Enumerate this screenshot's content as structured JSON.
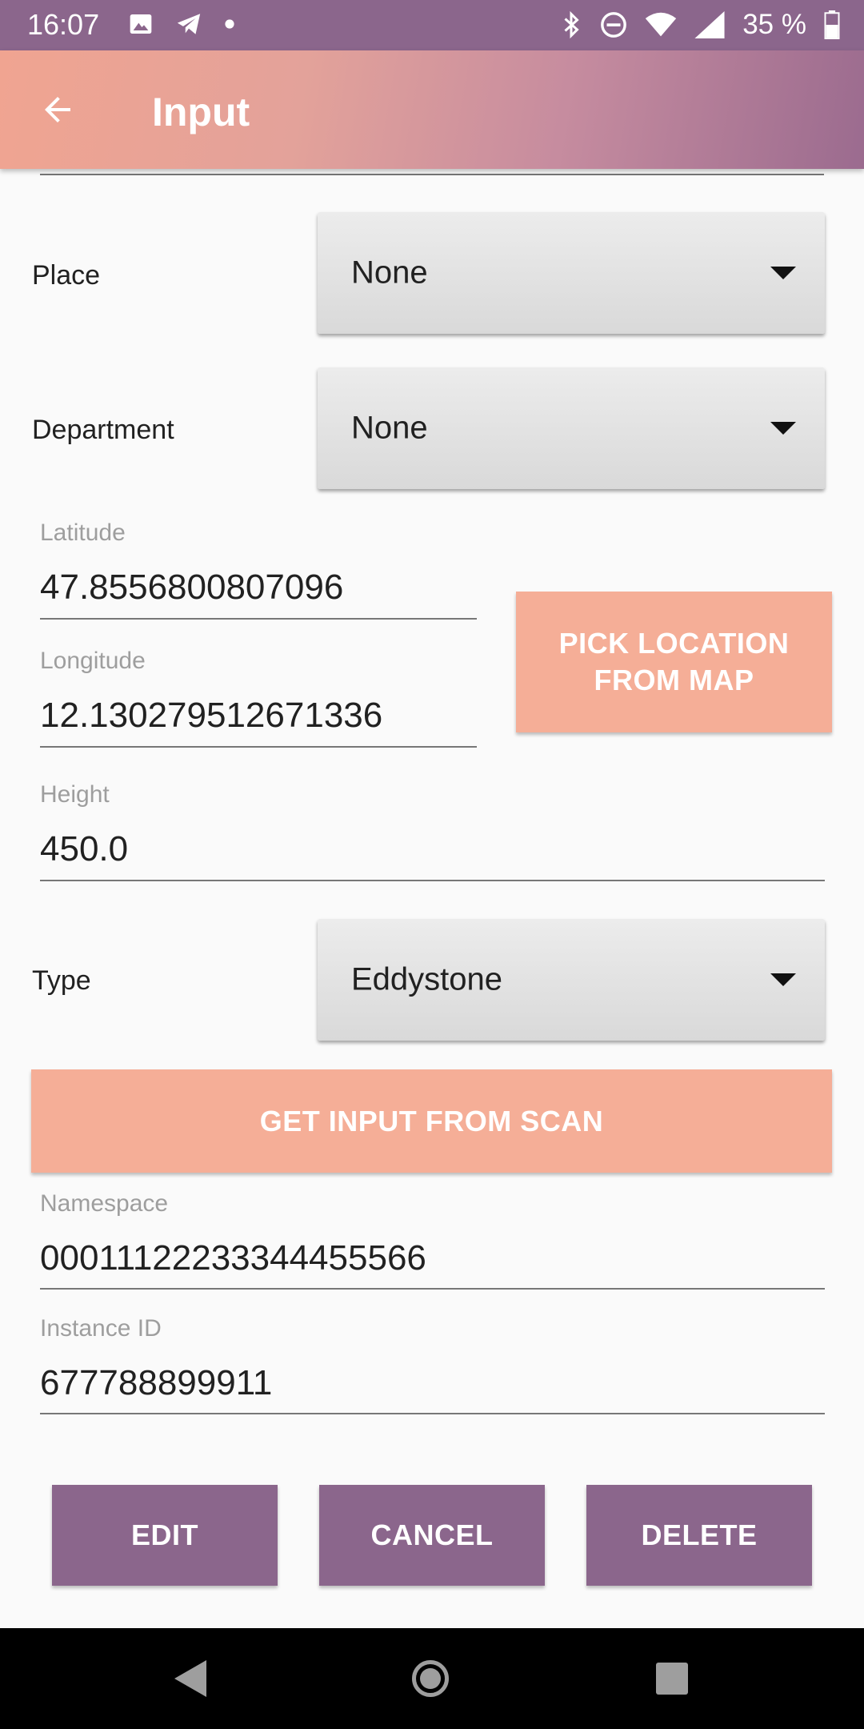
{
  "status_bar": {
    "time": "16:07",
    "battery_percent": "35 %",
    "left_icons": [
      "image-icon",
      "telegram-icon",
      "dot-icon"
    ],
    "right_icons": [
      "bluetooth-icon",
      "do-not-disturb-icon",
      "wifi-icon",
      "signal-icon",
      "battery-icon"
    ]
  },
  "app_bar": {
    "back_icon": "arrow-back-icon",
    "title": "Input"
  },
  "form": {
    "place": {
      "label": "Place",
      "value": "None"
    },
    "department": {
      "label": "Department",
      "value": "None"
    },
    "latitude": {
      "label": "Latitude",
      "value": "47.8556800807096"
    },
    "longitude": {
      "label": "Longitude",
      "value": "12.130279512671336"
    },
    "pick_location_button": "PICK LOCATION FROM MAP",
    "height": {
      "label": "Height",
      "value": "450.0"
    },
    "type": {
      "label": "Type",
      "value": "Eddystone"
    },
    "scan_button": "GET INPUT FROM SCAN",
    "namespace": {
      "label": "Namespace",
      "value": "00011122233344455566"
    },
    "instance_id": {
      "label": "Instance ID",
      "value": "677788899911"
    }
  },
  "actions": {
    "edit": "EDIT",
    "cancel": "CANCEL",
    "delete": "DELETE"
  },
  "colors": {
    "status_bar": "#8b668c",
    "accent_button": "#f5ae97",
    "primary_button": "#8b668c",
    "app_bar_gradient_start": "#f0a491",
    "app_bar_gradient_end": "#9b6b8f"
  },
  "nav_bar": {
    "icons": [
      "nav-back-icon",
      "nav-home-icon",
      "nav-recents-icon"
    ]
  }
}
